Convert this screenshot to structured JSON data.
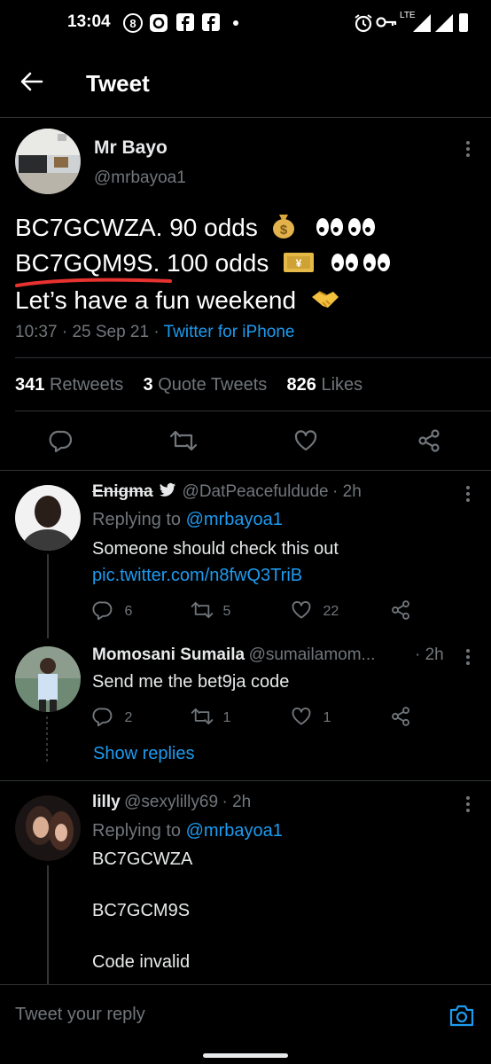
{
  "status_bar": {
    "time": "13:04",
    "network": "LTE"
  },
  "header": {
    "title": "Tweet"
  },
  "main_tweet": {
    "name": "Mr Bayo",
    "handle": "@mrbayoa1",
    "lines": [
      {
        "text": "BC7GCWZA. 90 odds",
        "emoji": "money-bag"
      },
      {
        "text": "BC7GQM9S.  100 odds",
        "emoji": "yen-banknote"
      },
      {
        "text": "Let’s have a fun weekend",
        "emoji": "handshake"
      }
    ],
    "time": "10:37",
    "date": "25 Sep 21",
    "source": "Twitter for iPhone",
    "retweets": "341",
    "retweets_label": "Retweets",
    "quote_tweets": "3",
    "quote_tweets_label": "Quote Tweets",
    "likes": "826",
    "likes_label": "Likes"
  },
  "replies": [
    {
      "name": "Enigma",
      "handle": "@DatPeacefuldude",
      "time": "2h",
      "replying_to_label": "Replying to",
      "replying_to": "@mrbayoa1",
      "text": "Someone should check this out",
      "link": "pic.twitter.com/n8fwQ3TriB",
      "replies": "6",
      "retweets": "5",
      "likes": "22"
    },
    {
      "name": "Momosani Sumaila",
      "handle": "@sumailamom...",
      "time": "2h",
      "text": "Send me the bet9ja code",
      "replies": "2",
      "retweets": "1",
      "likes": "1",
      "show_replies": "Show replies"
    },
    {
      "name": "lilly",
      "handle": "@sexylilly69",
      "time": "2h",
      "replying_to_label": "Replying to",
      "replying_to": "@mrbayoa1",
      "text_lines": [
        "BC7GCWZA",
        "BC7GCM9S",
        "Code invalid"
      ]
    }
  ],
  "composer": {
    "placeholder": "Tweet your reply"
  },
  "colors": {
    "accent": "#1d9bf0",
    "underline": "#e8322f",
    "background": "#000000",
    "muted": "#71767b"
  }
}
